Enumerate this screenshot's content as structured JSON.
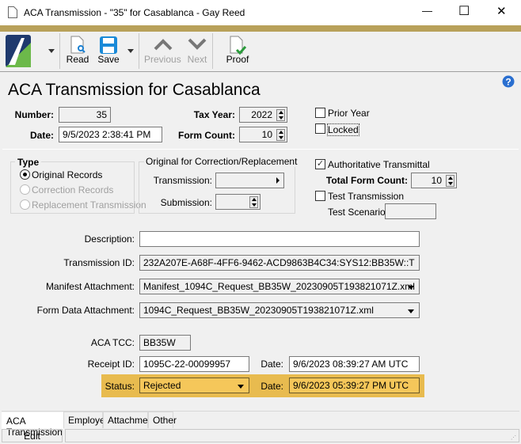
{
  "window": {
    "title": "ACA Transmission - \"35\" for Casablanca - Gay Reed",
    "minimize": "—",
    "maximize": "☐",
    "close": "✕"
  },
  "toolbar": {
    "read": "Read",
    "save": "Save",
    "previous": "Previous",
    "next": "Next",
    "proof": "Proof"
  },
  "page_title": "ACA Transmission for Casablanca",
  "header": {
    "number_label": "Number:",
    "number": "35",
    "date_label": "Date:",
    "date": "9/5/2023 2:38:41 PM",
    "tax_year_label": "Tax Year:",
    "tax_year": "2022",
    "form_count_label": "Form Count:",
    "form_count": "10",
    "prior_year": "Prior Year",
    "locked": "Locked"
  },
  "type_group": {
    "title": "Type",
    "options": [
      "Original Records",
      "Correction Records",
      "Replacement Transmission"
    ],
    "selected": "Original Records"
  },
  "original_group": {
    "title": "Original for Correction/Replacement",
    "transmission_label": "Transmission:",
    "submission_label": "Submission:"
  },
  "auth": {
    "authoritative": "Authoritative Transmittal",
    "authoritative_checked": true,
    "total_form_count_label": "Total Form Count:",
    "total_form_count": "10",
    "test_transmission": "Test Transmission",
    "test_scenario_label": "Test Scenario:"
  },
  "details": {
    "description_label": "Description:",
    "description": "",
    "transmission_id_label": "Transmission ID:",
    "transmission_id": "232A207E-A68F-4FF6-9462-ACD9863B4C34:SYS12:BB35W::T",
    "manifest_label": "Manifest Attachment:",
    "manifest": "Manifest_1094C_Request_BB35W_20230905T193821071Z.xml",
    "form_data_label": "Form Data Attachment:",
    "form_data": "1094C_Request_BB35W_20230905T193821071Z.xml",
    "tcc_label": "ACA TCC:",
    "tcc": "BB35W",
    "receipt_label": "Receipt ID:",
    "receipt": "1095C-22-00099957",
    "receipt_date_label": "Date:",
    "receipt_date": "9/6/2023 08:39:27 AM UTC",
    "status_label": "Status:",
    "status": "Rejected",
    "status_date_label": "Date:",
    "status_date": "9/6/2023 05:39:27 PM UTC"
  },
  "tabs": [
    "ACA Transmission",
    "Employees",
    "Attachments",
    "Other"
  ],
  "statusbar": {
    "mode": "Edit"
  },
  "colors": {
    "highlight": "#e8bb4f",
    "gold": "#b8a15a"
  }
}
